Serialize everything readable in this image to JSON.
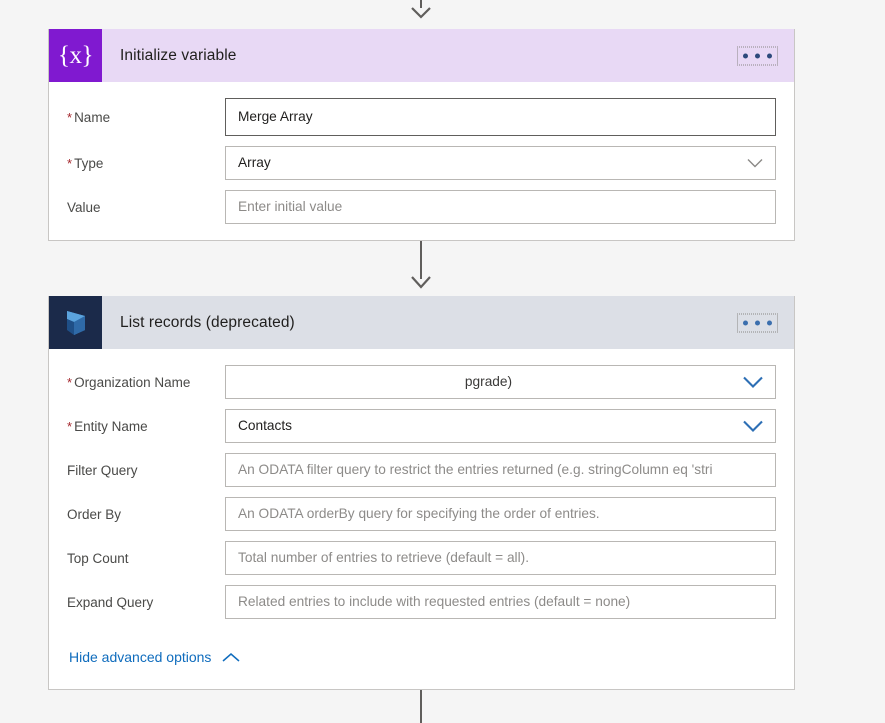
{
  "flow": {
    "cards": [
      {
        "id": "initialize-variable",
        "title": "Initialize variable",
        "icon": "variable-braces-icon",
        "icon_glyph": "{x}",
        "icon_bg": "#8019d0",
        "header_bg": "#e8d9f5",
        "menu_label": "more-commands",
        "fields": [
          {
            "label": "Name",
            "required": true,
            "value": "Merge Array",
            "placeholder": "",
            "control": "text",
            "focused": true
          },
          {
            "label": "Type",
            "required": true,
            "value": "Array",
            "placeholder": "",
            "control": "dropdown",
            "chevron": "gray"
          },
          {
            "label": "Value",
            "required": false,
            "value": "",
            "placeholder": "Enter initial value",
            "control": "text"
          }
        ]
      },
      {
        "id": "list-records-deprecated",
        "title": "List records (deprecated)",
        "icon": "dynamics-365-icon",
        "icon_bg": "#1b2a4a",
        "header_bg": "#dcdfe6",
        "menu_label": "more-commands",
        "fields": [
          {
            "label": "Organization Name",
            "required": true,
            "value": "pgrade)",
            "placeholder": "",
            "control": "dropdown",
            "chevron": "blue",
            "redacted": true
          },
          {
            "label": "Entity Name",
            "required": true,
            "value": "Contacts",
            "placeholder": "",
            "control": "dropdown",
            "chevron": "blue"
          },
          {
            "label": "Filter Query",
            "required": false,
            "value": "",
            "placeholder": "An ODATA filter query to restrict the entries returned (e.g. stringColumn eq 'stri",
            "control": "text"
          },
          {
            "label": "Order By",
            "required": false,
            "value": "",
            "placeholder": "An ODATA orderBy query for specifying the order of entries.",
            "control": "text"
          },
          {
            "label": "Top Count",
            "required": false,
            "value": "",
            "placeholder": "Total number of entries to retrieve (default = all).",
            "control": "text"
          },
          {
            "label": "Expand Query",
            "required": false,
            "value": "",
            "placeholder": "Related entries to include with requested entries (default = none)",
            "control": "text"
          }
        ],
        "advanced_options_label": "Hide advanced options",
        "advanced_options_state": "expanded"
      }
    ],
    "connector_color": "#605e5c",
    "required_marker": "*",
    "required_marker_color": "#a4262c",
    "link_color": "#0f6cbd"
  }
}
